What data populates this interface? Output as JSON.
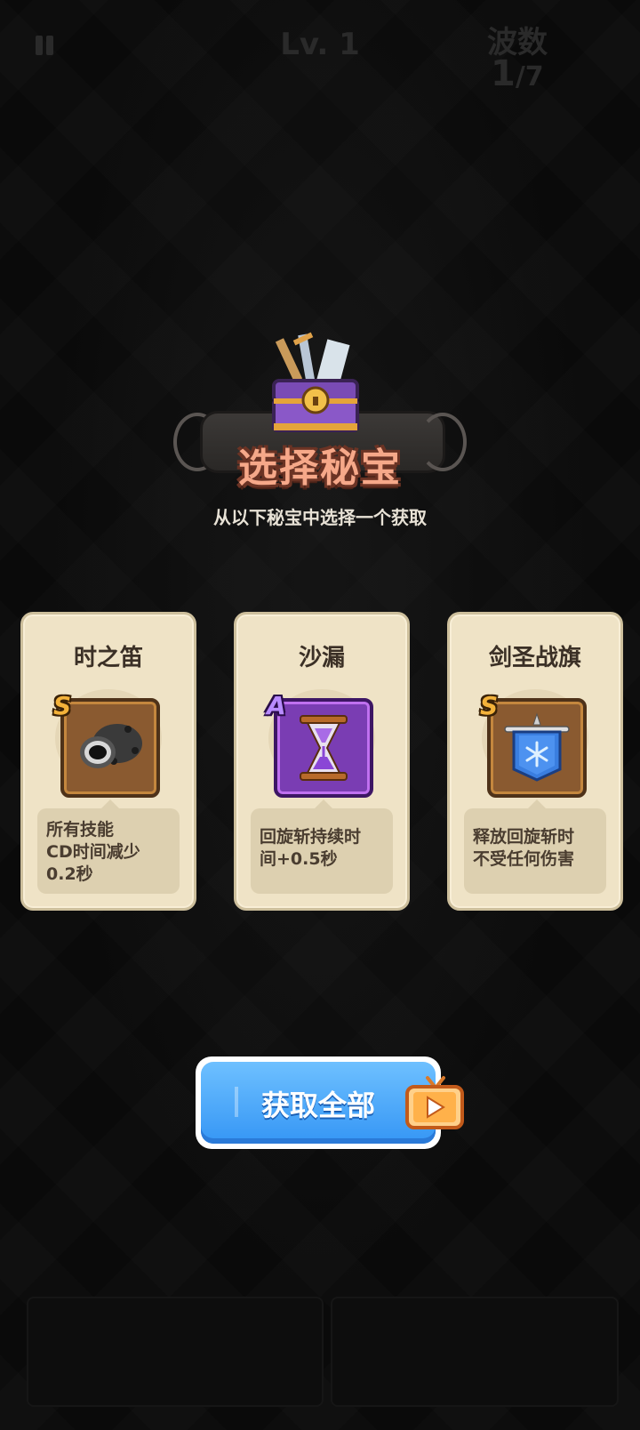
{
  "hud": {
    "level": "Lv. 1",
    "wave_label": "波数",
    "wave_current": "1",
    "wave_total": "/7"
  },
  "dialog": {
    "title": "选择秘宝",
    "subtitle": "从以下秘宝中选择一个获取"
  },
  "cards": [
    {
      "name": "时之笛",
      "grade": "S",
      "icon": "cannon-flute-icon",
      "desc_lines": [
        "所有技能",
        "CD时间减少",
        "0.2秒"
      ]
    },
    {
      "name": "沙漏",
      "grade": "A",
      "icon": "hourglass-icon",
      "desc_lines": [
        "回旋斩持续时",
        "间+0.5秒"
      ]
    },
    {
      "name": "剑圣战旗",
      "grade": "S",
      "icon": "blue-banner-icon",
      "desc_lines": [
        "释放回旋斩时",
        "不受任何伤害"
      ]
    }
  ],
  "get_all_button": {
    "label": "获取全部",
    "badge_icon": "video-ad-icon"
  },
  "colors": {
    "title_fill": "#f6a889",
    "button_blue": "#3596f5",
    "card_bg": "#efe3c6",
    "grade_s": "#f3b23a",
    "grade_a": "#b88bff"
  }
}
